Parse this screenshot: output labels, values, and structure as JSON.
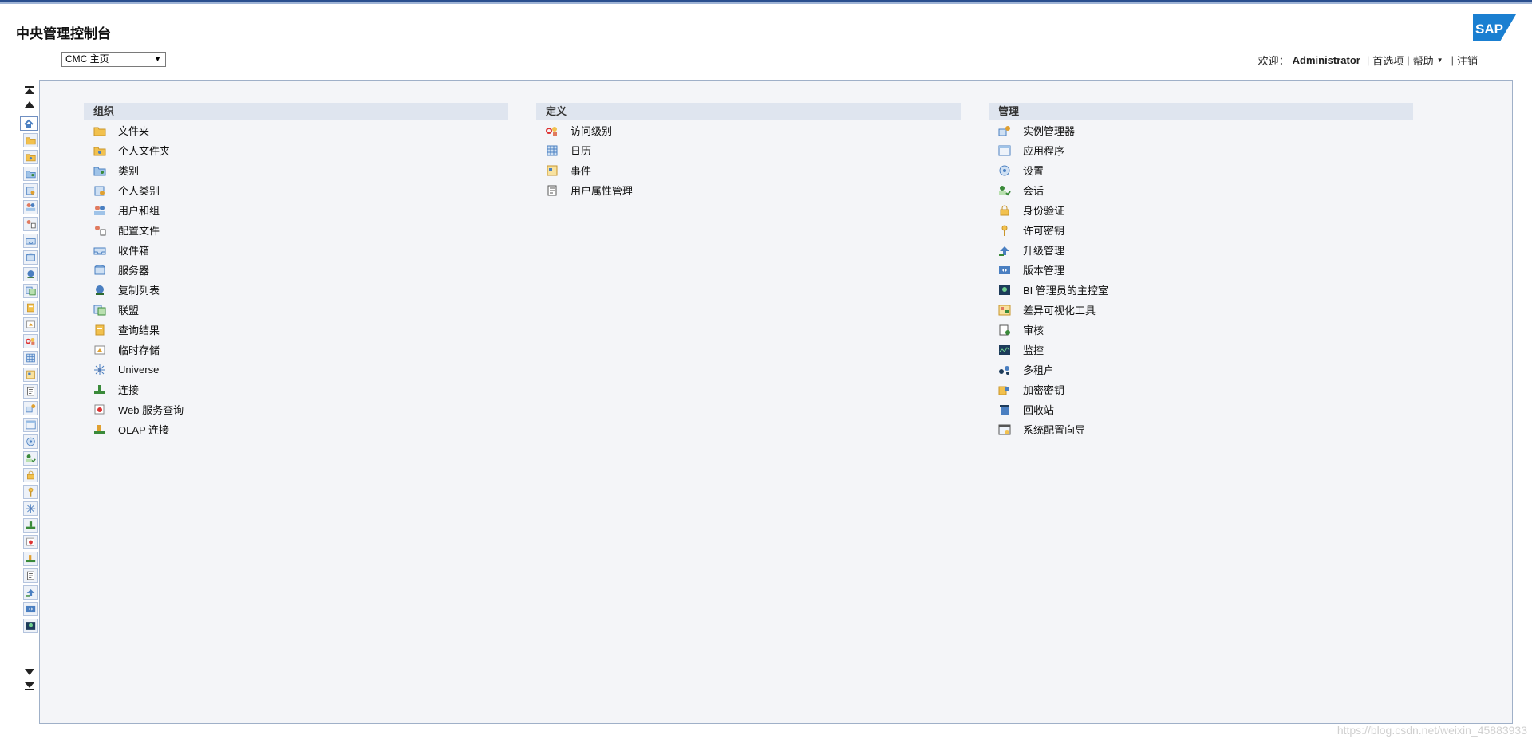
{
  "header": {
    "title": "中央管理控制台",
    "logo_text": "SAP",
    "nav_select_value": "CMC 主页"
  },
  "userbar": {
    "welcome": "欢迎：",
    "username": "Administrator",
    "sep": "|",
    "preferences": "首选项",
    "help": "帮助",
    "logoff": "注销"
  },
  "sections": {
    "organize": {
      "title": "组织",
      "items": [
        "文件夹",
        "个人文件夹",
        "类别",
        "个人类别",
        "用户和组",
        "配置文件",
        "收件箱",
        "服务器",
        "复制列表",
        "联盟",
        "查询结果",
        "临时存储",
        "Universe",
        "连接",
        "Web 服务查询",
        "OLAP 连接"
      ]
    },
    "define": {
      "title": "定义",
      "items": [
        "访问级别",
        "日历",
        "事件",
        "用户属性管理"
      ]
    },
    "manage": {
      "title": "管理",
      "items": [
        "实例管理器",
        "应用程序",
        "设置",
        "会话",
        "身份验证",
        "许可密钥",
        "升级管理",
        "版本管理",
        "BI 管理员的主控室",
        "差异可视化工具",
        "审核",
        "监控",
        "多租户",
        "加密密钥",
        "回收站",
        "系统配置向导"
      ]
    }
  },
  "watermark": "https://blog.csdn.net/weixin_45883933",
  "colors": {
    "brand_blue": "#2a4f8f",
    "header_bg": "#dfe5ef",
    "panel_bg": "#f4f5f8"
  }
}
